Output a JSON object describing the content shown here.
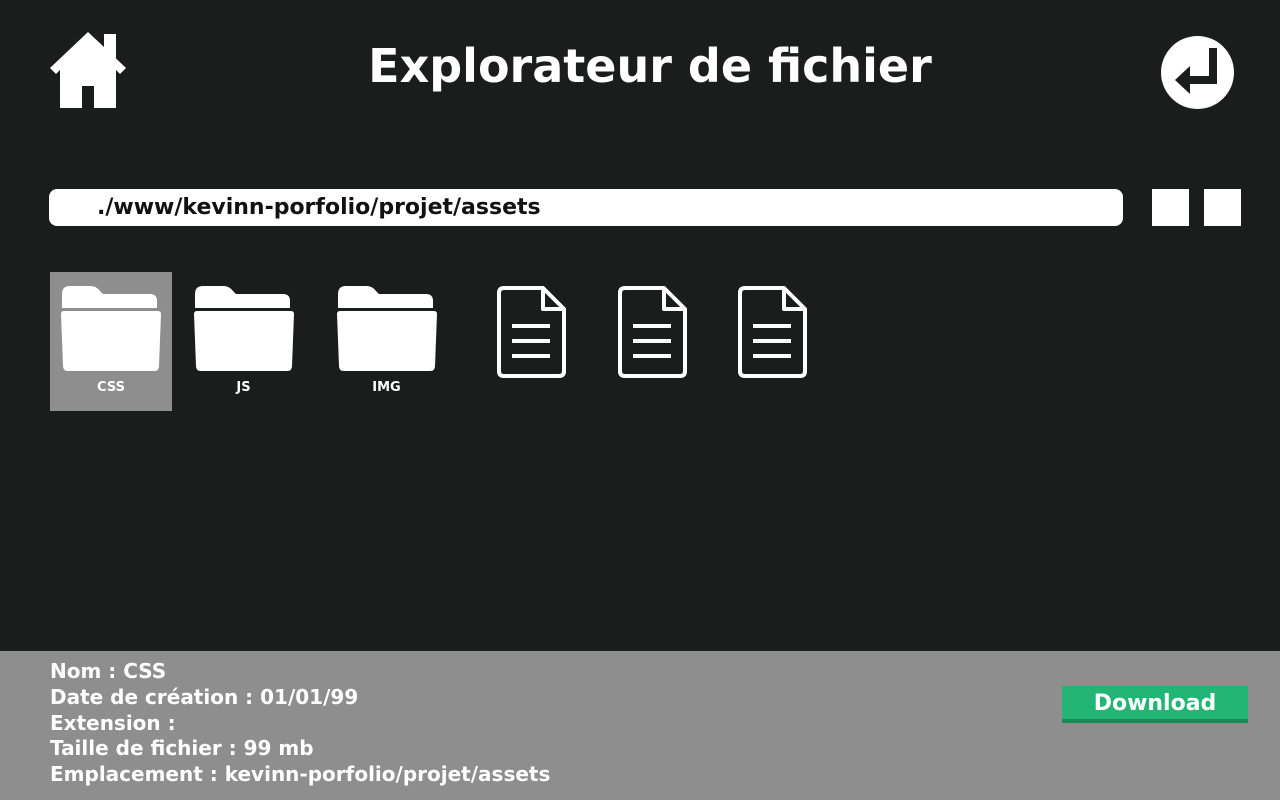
{
  "header": {
    "title": "Explorateur de fichier",
    "home_icon": "home-icon",
    "back_icon": "return-arrow-icon"
  },
  "path_bar": {
    "value": "./www/kevinn-porfolio/projet/assets"
  },
  "colors": {
    "background": "#1b1c1c",
    "panel": "#8e8e8e",
    "selected": "#8e8e8e",
    "download": "#22b573"
  },
  "items": [
    {
      "type": "folder",
      "label": "CSS",
      "selected": true,
      "icon": "folder-icon"
    },
    {
      "type": "folder",
      "label": "JS",
      "selected": false,
      "icon": "folder-icon"
    },
    {
      "type": "folder",
      "label": "IMG",
      "selected": false,
      "icon": "folder-icon"
    },
    {
      "type": "file",
      "label": "",
      "selected": false,
      "icon": "document-icon"
    },
    {
      "type": "file",
      "label": "",
      "selected": false,
      "icon": "document-icon"
    },
    {
      "type": "file",
      "label": "",
      "selected": false,
      "icon": "document-icon"
    }
  ],
  "details": {
    "name": "Nom : CSS",
    "created": "Date de création : 01/01/99",
    "extension": "Extension :",
    "size": "Taille de fichier : 99 mb",
    "location": "Emplacement : kevinn-porfolio/projet/assets"
  },
  "download": {
    "label": "Download"
  }
}
